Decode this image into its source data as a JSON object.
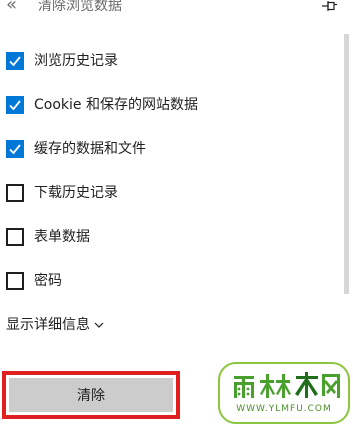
{
  "panel": {
    "title": "清除浏览数据",
    "back_icon_glyph": "«",
    "pin_icon": "pin-icon"
  },
  "options": [
    {
      "label": "浏览历史记录",
      "checked": true
    },
    {
      "label": "Cookie 和保存的网站数据",
      "checked": true
    },
    {
      "label": "缓存的数据和文件",
      "checked": true
    },
    {
      "label": "下载历史记录",
      "checked": false
    },
    {
      "label": "表单数据",
      "checked": false
    },
    {
      "label": "密码",
      "checked": false
    }
  ],
  "details": {
    "label": "显示详细信息"
  },
  "actions": {
    "clear_label": "清除"
  },
  "watermark": {
    "logo_text": "雨林木风",
    "url": "WWW.YLMFU.COM"
  },
  "colors": {
    "accent": "#0078d7",
    "highlight_border": "#e02020",
    "button_bg": "#cccccc",
    "watermark_green": "#8cc63f"
  }
}
